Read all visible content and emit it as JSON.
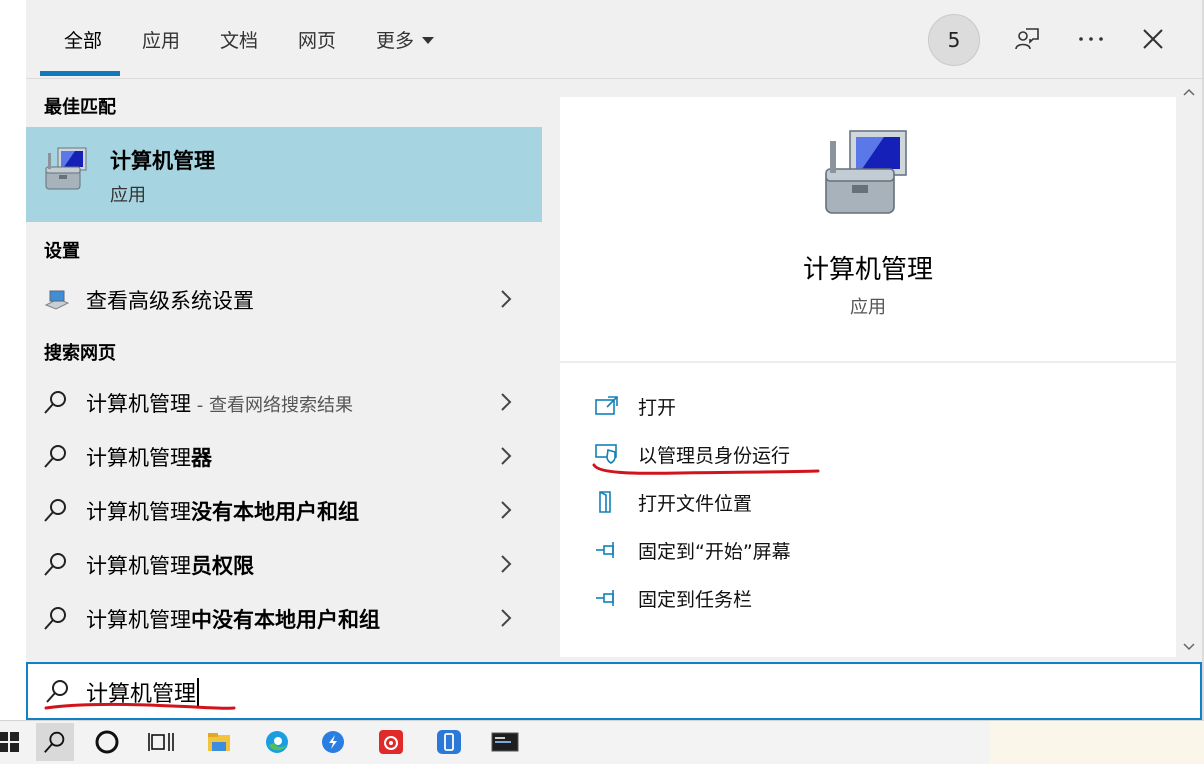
{
  "tabs": [
    {
      "label": "全部"
    },
    {
      "label": "应用"
    },
    {
      "label": "文档"
    },
    {
      "label": "网页"
    },
    {
      "label": "更多"
    }
  ],
  "header": {
    "badge_count": "5"
  },
  "sections": {
    "best_match": "最佳匹配",
    "settings": "设置",
    "web_search": "搜索网页"
  },
  "best_match": {
    "title": "计算机管理",
    "subtitle": "应用"
  },
  "settings_items": [
    {
      "label": "查看高级系统设置"
    }
  ],
  "web_results": [
    {
      "prefix": "计算机管理",
      "bold": "",
      "hint": " - 查看网络搜索结果"
    },
    {
      "prefix": "计算机管理",
      "bold": "器",
      "hint": ""
    },
    {
      "prefix": "计算机管理",
      "bold": "没有本地用户和组",
      "hint": ""
    },
    {
      "prefix": "计算机管理",
      "bold": "员权限",
      "hint": ""
    },
    {
      "prefix": "计算机管理",
      "bold": "中没有本地用户和组",
      "hint": ""
    }
  ],
  "detail": {
    "title": "计算机管理",
    "subtitle": "应用",
    "actions": [
      {
        "label": "打开",
        "icon": "open-window-icon"
      },
      {
        "label": "以管理员身份运行",
        "icon": "shield-icon"
      },
      {
        "label": "打开文件位置",
        "icon": "file-location-icon"
      },
      {
        "label": "固定到“开始”屏幕",
        "icon": "pin-icon"
      },
      {
        "label": "固定到任务栏",
        "icon": "pin-icon"
      }
    ]
  },
  "search": {
    "value": "计算机管理"
  },
  "colors": {
    "accent": "#0f7bbd",
    "selection": "#a6d4e0",
    "annotation": "#d0141b"
  }
}
